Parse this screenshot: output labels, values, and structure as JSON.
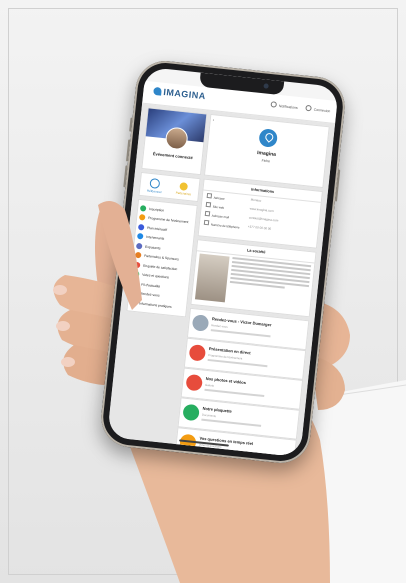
{
  "app": {
    "logo_text": "IMAGINA",
    "top_links": [
      "Notifications",
      "Connexion"
    ]
  },
  "profile": {
    "name": "Événement connecté",
    "quick_actions": [
      {
        "label": "Référencer",
        "icon": "fingerprint-icon"
      },
      {
        "label": "Partenaires",
        "icon": "star-icon"
      }
    ]
  },
  "menu": {
    "items": [
      {
        "label": "Inscription",
        "color": "#27ae60"
      },
      {
        "label": "Programme de l'évènement",
        "color": "#f39c12"
      },
      {
        "label": "Plan intéractif",
        "color": "#3b5bdb"
      },
      {
        "label": "Intervenants",
        "color": "#1e88e5"
      },
      {
        "label": "Exposants",
        "color": "#5c6bc0"
      },
      {
        "label": "Partenaires & Sponsors",
        "color": "#e67e22"
      },
      {
        "label": "Enquête de satisfaction",
        "color": "#e74c3c"
      },
      {
        "label": "Votes et questions",
        "color": "#2ecc71"
      },
      {
        "label": "Fil d'actualité",
        "color": "#e84393"
      },
      {
        "label": "Rendez-vous",
        "color": "#8e44ad"
      },
      {
        "label": "Informations pratiques",
        "color": "#7f4f24"
      }
    ]
  },
  "fiche": {
    "title": "Imagina",
    "subtitle": "Fiche"
  },
  "informations": {
    "title": "Informations",
    "rows": [
      {
        "key": "Adresse",
        "value": "Monaco"
      },
      {
        "key": "Site web",
        "value": "www.imagina.com"
      },
      {
        "key": "Adresse mail",
        "value": "contact@imagina.com"
      },
      {
        "key": "Numéro de téléphone",
        "value": "+377 00 00 00 00"
      }
    ]
  },
  "societe": {
    "title": "La société"
  },
  "feed": {
    "items": [
      {
        "title": "Rendez-vous - Victor Dumarger",
        "subtitle": "Rendez-vous",
        "color": "#9aa9b8"
      },
      {
        "title": "Présentation en direct",
        "subtitle": "Programme de l'évènement",
        "color": "#e74c3c"
      },
      {
        "title": "Nos photos et vidéos",
        "subtitle": "Galerie",
        "color": "#e74c3c"
      },
      {
        "title": "Notre plaquette",
        "subtitle": "Documents",
        "color": "#27ae60"
      },
      {
        "title": "Vos questions en temps réel",
        "subtitle": "Votes et questions",
        "color": "#f39c12"
      }
    ]
  },
  "colors": {
    "accent": "#2f86c9",
    "background": "#e6e6e6",
    "phone_frame": "#1c1c1e"
  }
}
